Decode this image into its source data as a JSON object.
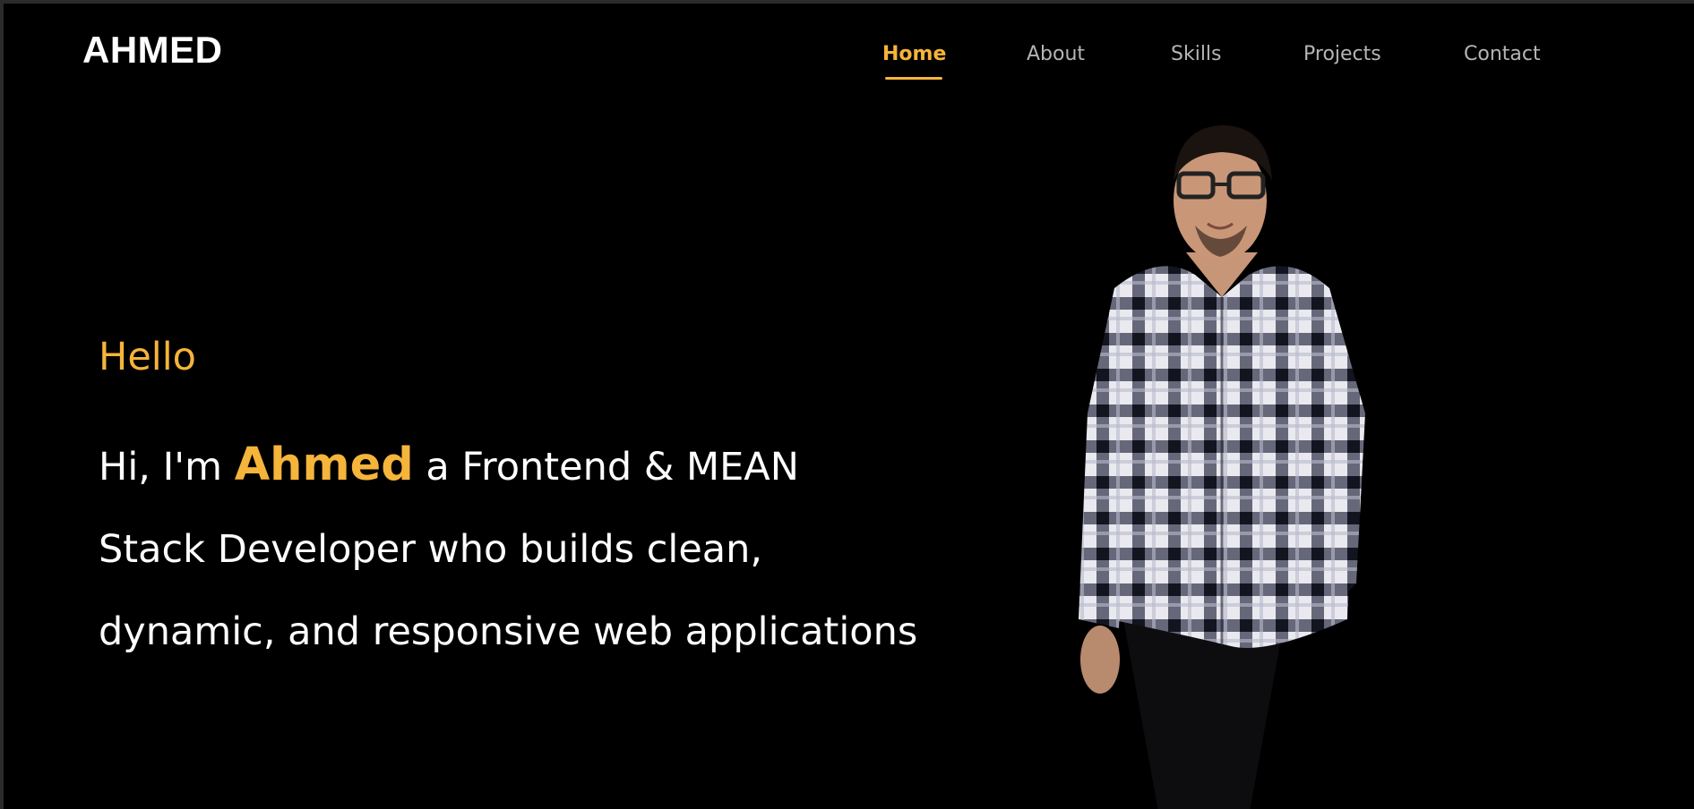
{
  "brand": {
    "logo_text": "AHMED"
  },
  "nav": {
    "items": [
      {
        "label": "Home",
        "active": true
      },
      {
        "label": "About",
        "active": false
      },
      {
        "label": "Skills",
        "active": false
      },
      {
        "label": "Projects",
        "active": false
      },
      {
        "label": "Contact",
        "active": false
      }
    ]
  },
  "hero": {
    "greeting": "Hello",
    "intro_prefix": "Hi, I'm ",
    "intro_name": "Ahmed",
    "intro_line1_suffix": " a Frontend & MEAN",
    "intro_line2": "Stack Developer who builds clean,",
    "intro_line3": "dynamic, and responsive web applications"
  },
  "colors": {
    "accent": "#f5b43a",
    "background": "#000000",
    "nav_text": "#b5b5b5",
    "text": "#ffffff"
  },
  "icons": {
    "profile_photo": "portrait-photo"
  }
}
